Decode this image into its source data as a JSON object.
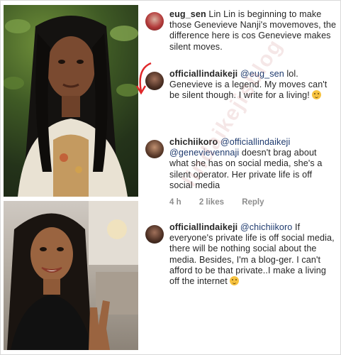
{
  "comments": [
    {
      "username": "eug_sen",
      "segments": [
        {
          "t": "Lin Lin is beginning to make those Genevieve Nanji's movemoves, the difference here is cos Genevieve makes silent moves.",
          "m": false
        }
      ],
      "emoji": false
    },
    {
      "username": "officiallindaikeji",
      "segments": [
        {
          "t": "@eug_sen",
          "m": true
        },
        {
          "t": " lol. Genevieve is a legend. My moves can't be silent though. I write for a living! ",
          "m": false
        }
      ],
      "emoji": true
    },
    {
      "username": "chichiikoro",
      "segments": [
        {
          "t": "@officiallindaikeji",
          "m": true
        },
        {
          "t": " ",
          "m": false
        },
        {
          "t": "@genevievennaji",
          "m": true
        },
        {
          "t": " doesn't brag about what she has on social media, she's a silent operator. Her private life is off social media",
          "m": false
        }
      ],
      "emoji": false,
      "meta": {
        "time": "4 h",
        "likes": "2 likes",
        "reply": "Reply"
      }
    },
    {
      "username": "officiallindaikeji",
      "segments": [
        {
          "t": "@chichiikoro",
          "m": true
        },
        {
          "t": " If everyone's private life is off social media, there will be nothing social about the media. Besides, I'm a blog-ger. I can't afford to be that private..I make a living off the internet ",
          "m": false
        }
      ],
      "emoji": true
    }
  ],
  "watermark_text": "lindaikejisblog",
  "colors": {
    "mention": "#1e3a6e",
    "annotation": "#e0282a",
    "meta": "#8e8e8e"
  }
}
